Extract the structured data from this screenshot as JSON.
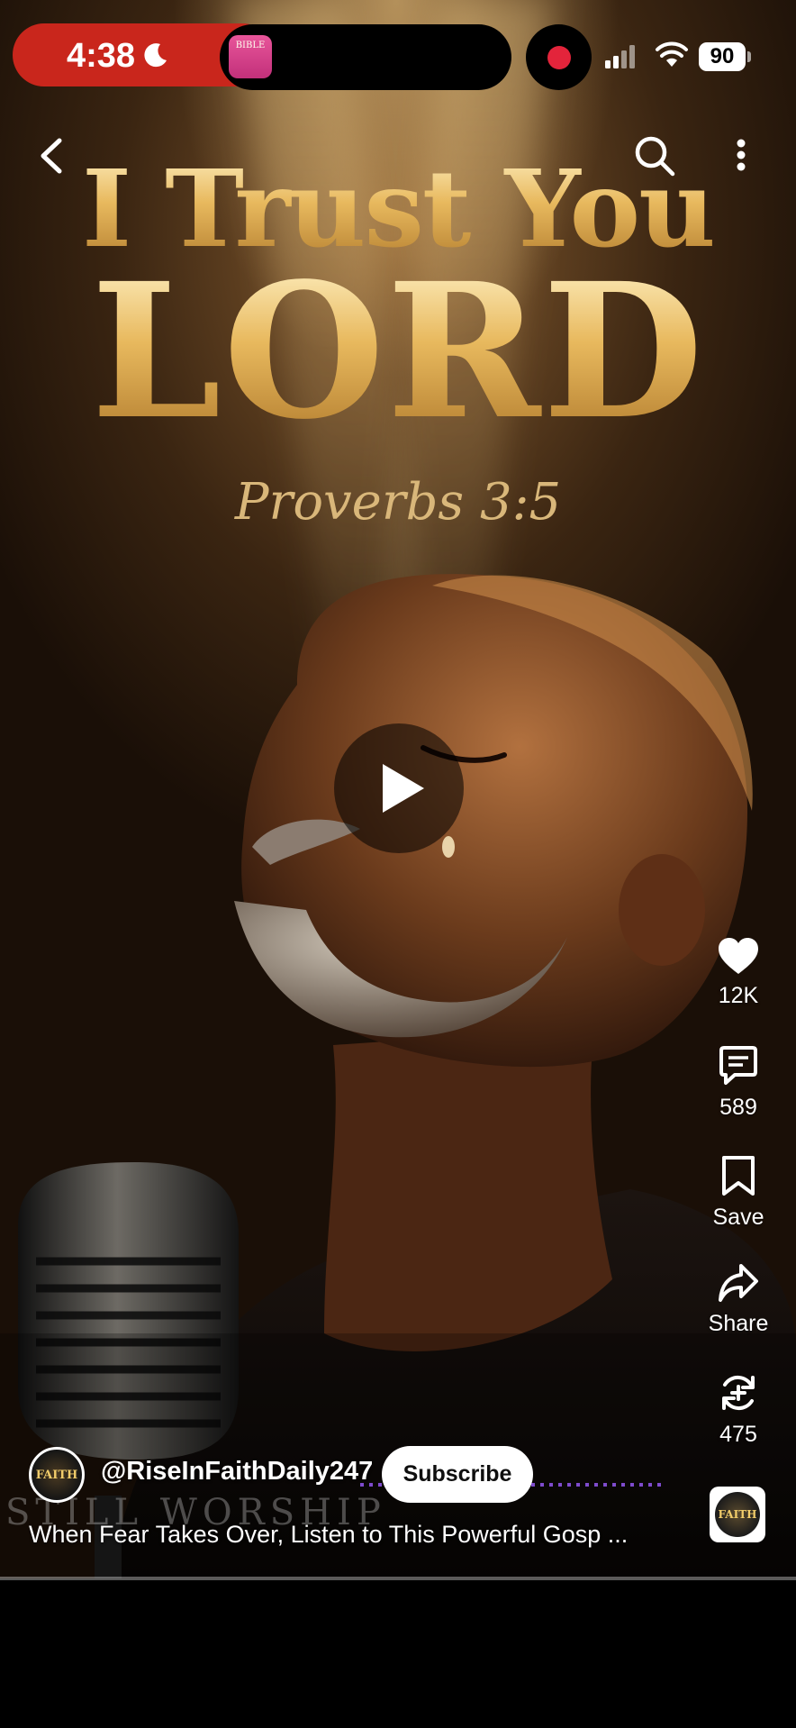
{
  "status_bar": {
    "time": "4:38",
    "battery": "90",
    "notification_app_text": "BIBLE"
  },
  "artwork": {
    "line1": "I Trust You",
    "line2": "LORD",
    "reference": "Proverbs 3:5",
    "watermark": "STILL WORSHIP"
  },
  "actions": {
    "likes": "12K",
    "comments": "589",
    "save_label": "Save",
    "share_label": "Share",
    "remixes": "475"
  },
  "channel": {
    "handle": "@RiseInFaithDaily247",
    "subscribe_label": "Subscribe",
    "avatar_text": "FAITH"
  },
  "video": {
    "title": "When Fear Takes Over, Listen to This Powerful Gosp ...",
    "progress": 0.0
  },
  "colors": {
    "record_red": "#e3243b",
    "status_pill": "#c9261c",
    "gold": "#e8b95e"
  },
  "icons": [
    "back-arrow-icon",
    "search-icon",
    "more-vert-icon",
    "heart-icon",
    "comment-icon",
    "bookmark-icon",
    "share-icon",
    "remix-icon",
    "play-icon"
  ]
}
